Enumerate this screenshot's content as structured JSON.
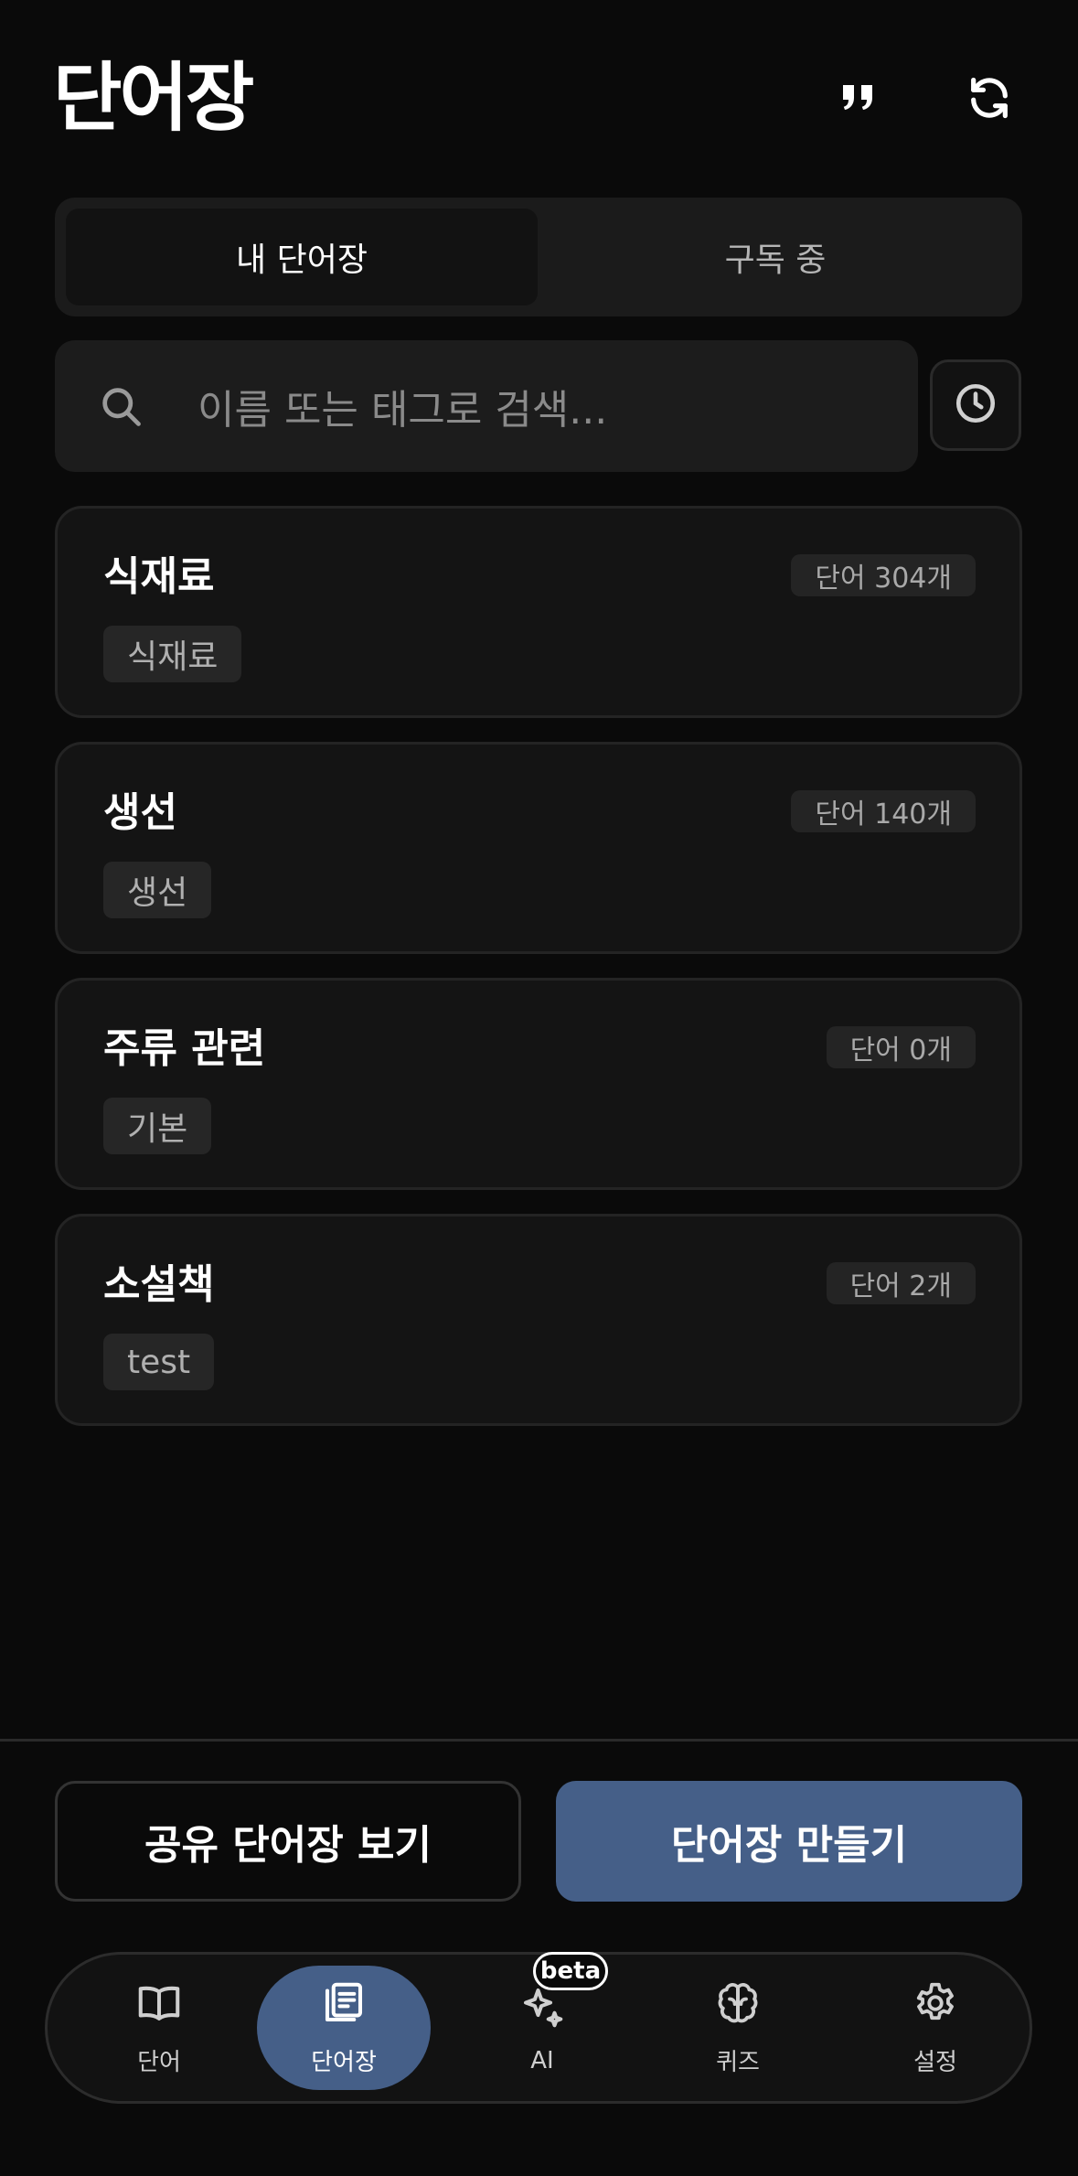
{
  "header": {
    "title": "단어장",
    "quote_icon": "quote-icon",
    "refresh_icon": "refresh-icon"
  },
  "tabs": [
    {
      "label": "내 단어장",
      "active": true
    },
    {
      "label": "구독 중",
      "active": false
    }
  ],
  "search": {
    "placeholder": "이름 또는 태그로 검색...",
    "icon": "search-icon",
    "history_icon": "clock-icon"
  },
  "wordbooks": [
    {
      "name": "식재료",
      "count": "단어 304개",
      "tag": "식재료"
    },
    {
      "name": "생선",
      "count": "단어 140개",
      "tag": "생선"
    },
    {
      "name": "주류 관련",
      "count": "단어 0개",
      "tag": "기본"
    },
    {
      "name": "소설책",
      "count": "단어 2개",
      "tag": "test"
    }
  ],
  "actions": {
    "shared_label": "공유 단어장 보기",
    "create_label": "단어장 만들기"
  },
  "nav": {
    "items": [
      {
        "label": "단어",
        "icon": "book-icon"
      },
      {
        "label": "단어장",
        "icon": "notebooks-icon",
        "active": true
      },
      {
        "label": "AI",
        "icon": "sparkle-icon",
        "badge": "beta"
      },
      {
        "label": "퀴즈",
        "icon": "brain-icon"
      },
      {
        "label": "설정",
        "icon": "gear-icon"
      }
    ]
  },
  "colors": {
    "background": "#0a0a0a",
    "accent": "#455f88",
    "card": "#141414"
  }
}
